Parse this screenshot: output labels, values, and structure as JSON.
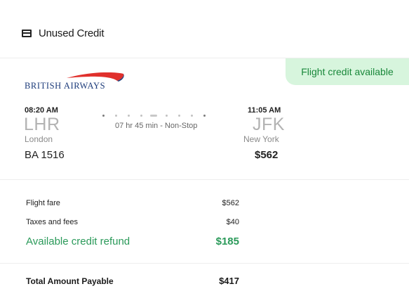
{
  "header": {
    "title": "Unused Credit",
    "icon": "credit-card-icon"
  },
  "flight": {
    "badge": "Flight credit available",
    "airline_logo_text": "BRITISH AIRWAYS",
    "departure": {
      "time": "08:20 AM",
      "code": "LHR",
      "city": "London"
    },
    "arrival": {
      "time": "11:05 AM",
      "code": "JFK",
      "city": "New York"
    },
    "duration": "07 hr 45 min -  Non-Stop",
    "flight_number": "BA 1516",
    "price": "$562"
  },
  "fare": {
    "flight_fare_label": "Flight fare",
    "flight_fare_value": "$562",
    "taxes_label": "Taxes and fees",
    "taxes_value": "$40",
    "credit_label": "Available credit refund",
    "credit_value": "$185"
  },
  "total": {
    "label": "Total Amount Payable",
    "value": "$417"
  },
  "colors": {
    "badge_bg": "#d7f5dd",
    "badge_text": "#19883a",
    "credit_green": "#2b9a5a",
    "ba_blue": "#1c3b7a",
    "ba_red": "#e0302c"
  }
}
